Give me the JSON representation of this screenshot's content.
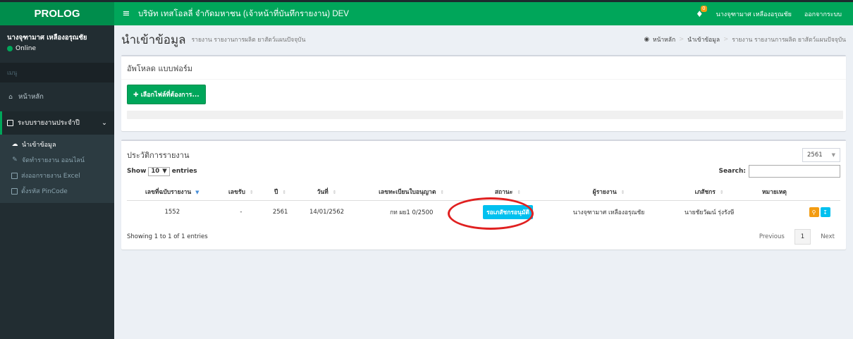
{
  "sidebar": {
    "logo": "PROLOG",
    "user_name": "นางจุฑามาศ เหลืองอรุณชัย",
    "user_status": "Online",
    "menu_header": "เมนู",
    "home": "หน้าหลัก",
    "section": "ระบบรายงานประจำปี",
    "sub_items": [
      "นำเข้าข้อมูล",
      "จัดทำรายงาน ออนไลน์",
      "ส่งออกรายงาน Excel",
      "ตั้งรหัส PinCode"
    ]
  },
  "topbar": {
    "company": "บริษัท เทสโอลลี่ จำกัดมหาชน (เจ้าหน้าที่บันทึกรายงาน) DEV",
    "notification_count": "0",
    "user": "นางจุฑามาศ เหลืองอรุณชัย",
    "logout": "ออกจากระบบ"
  },
  "page": {
    "title": "นำเข้าข้อมูล",
    "subtitle": "รายงาน รายงานการผลิต ยาสัตว์แผนปัจจุบัน",
    "breadcrumb": [
      "หน้าหลัก",
      "นำเข้าข้อมูล",
      "รายงาน รายงานการผลิต ยาสัตว์แผนปัจจุบัน"
    ]
  },
  "upload": {
    "title": "อัพโหลด แบบฟอร์ม",
    "button": "เลือกไฟล์ที่ต้องการ...",
    "progress": 0
  },
  "history": {
    "title": "ประวัติการรายงาน",
    "year": "2561",
    "show_label": "Show",
    "entries_label": "entries",
    "page_length": "10",
    "search_label": "Search:",
    "columns": [
      "เลขที่ฉบับรายงาน",
      "เลขรับ",
      "ปี",
      "วันที่",
      "เลขทะเบียนใบอนุญาต",
      "สถานะ",
      "ผู้รายงาน",
      "เภสัชกร",
      "หมายเหตุ"
    ],
    "rows": [
      {
        "report_no": "1552",
        "recv_no": "-",
        "year": "2561",
        "date": "14/01/2562",
        "license": "กท ผย1 0/2500",
        "status": "รอเภสัชกรอนุมัติ",
        "reporter": "นางจุฑามาศ เหลืองอรุณชัย",
        "pharmacist": "นายชัยวัฒน์ รุ่งรังษี",
        "note": ""
      }
    ],
    "info": "Showing 1 to 1 of 1 entries",
    "prev": "Previous",
    "page": "1",
    "next": "Next"
  },
  "colors": {
    "green": "#00a65a",
    "sidebar": "#222d32",
    "info": "#00c0ef",
    "warning": "#f39c12",
    "highlight": "#e02020"
  }
}
